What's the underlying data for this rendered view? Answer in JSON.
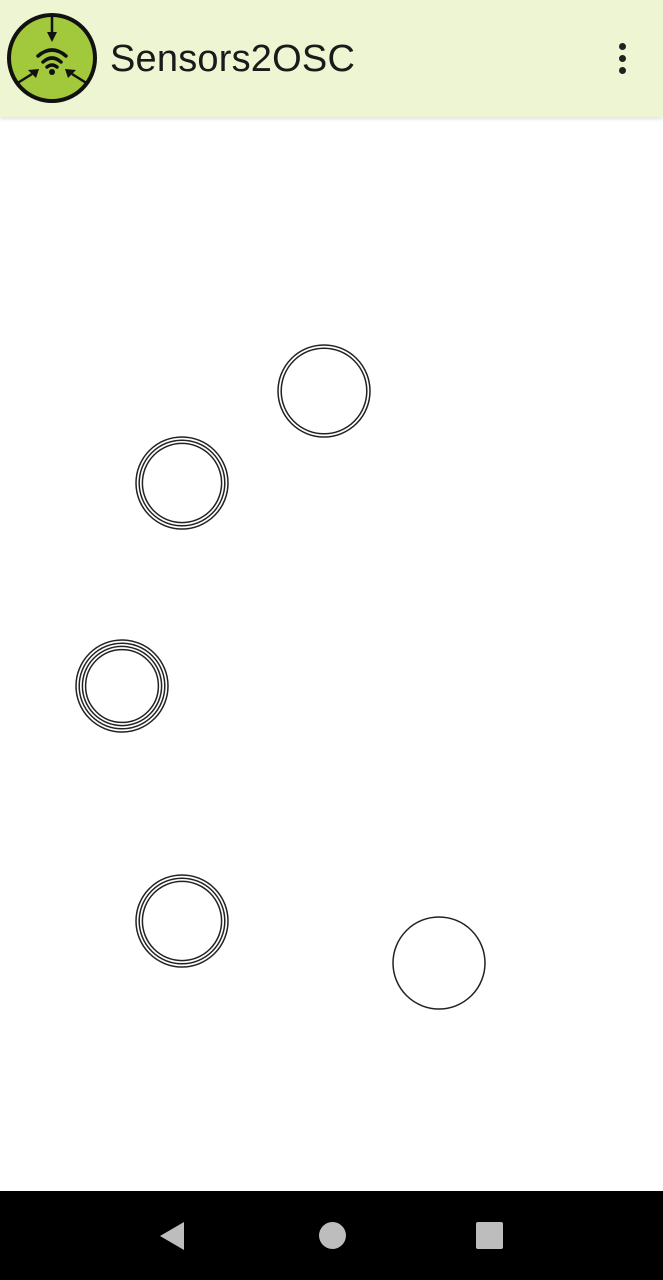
{
  "app_bar": {
    "title": "Sensors2OSC",
    "logo_icon": "sensors2osc-logo-icon",
    "menu_icon": "overflow-menu-icon",
    "background": "#edf5d3",
    "logo_color": "#a2c83c"
  },
  "touch_canvas": {
    "touch_points": [
      {
        "rings": 2
      },
      {
        "rings": 3
      },
      {
        "rings": 4
      },
      {
        "rings": 3
      },
      {
        "rings": 1
      }
    ]
  },
  "navigation_bar": {
    "back_icon": "back-triangle-icon",
    "home_icon": "home-circle-icon",
    "recents_icon": "recents-square-icon"
  }
}
